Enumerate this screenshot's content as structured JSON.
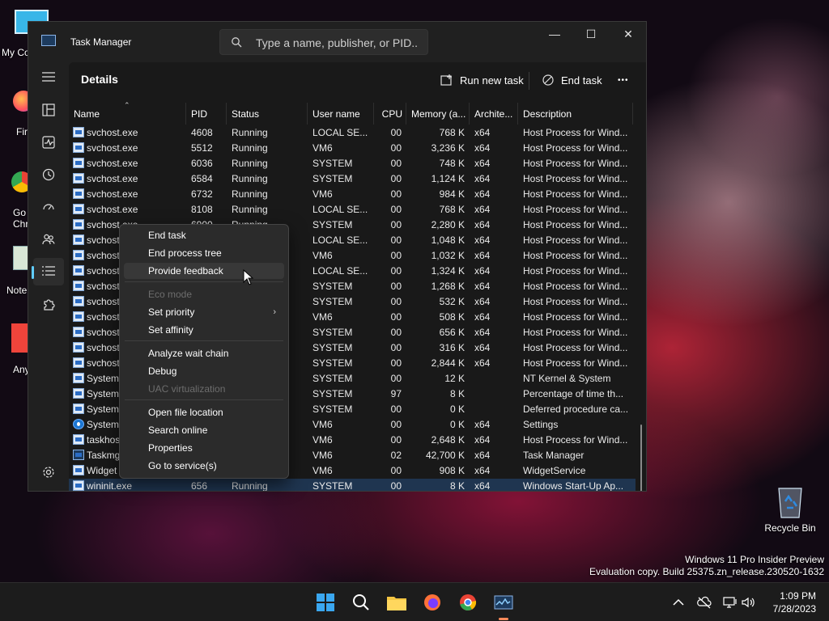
{
  "desktop": {
    "icons": [
      {
        "label": "My Co"
      },
      {
        "label": "Fir"
      },
      {
        "label": "Go Chr"
      },
      {
        "label": "Note"
      },
      {
        "label": "Any"
      }
    ],
    "recycle_bin": "Recycle Bin",
    "watermark_line1": "Windows 11 Pro Insider Preview",
    "watermark_line2": "Evaluation copy. Build 25375.zn_release.230520-1632"
  },
  "window": {
    "title": "Task Manager",
    "search_placeholder": "Type a name, publisher, or PID...",
    "minimize": "—",
    "maximize": "☐",
    "close": "✕"
  },
  "toolbar": {
    "page_title": "Details",
    "run_new_task": "Run new task",
    "end_task": "End task",
    "more": "•••"
  },
  "table": {
    "columns": [
      "Name",
      "PID",
      "Status",
      "User name",
      "CPU",
      "Memory (a...",
      "Archite...",
      "Description"
    ],
    "rows": [
      {
        "name": "svchost.exe",
        "pid": "4608",
        "status": "Running",
        "user": "LOCAL SE...",
        "cpu": "00",
        "mem": "768 K",
        "arch": "x64",
        "desc": "Host Process for Wind..."
      },
      {
        "name": "svchost.exe",
        "pid": "5512",
        "status": "Running",
        "user": "VM6",
        "cpu": "00",
        "mem": "3,236 K",
        "arch": "x64",
        "desc": "Host Process for Wind..."
      },
      {
        "name": "svchost.exe",
        "pid": "6036",
        "status": "Running",
        "user": "SYSTEM",
        "cpu": "00",
        "mem": "748 K",
        "arch": "x64",
        "desc": "Host Process for Wind..."
      },
      {
        "name": "svchost.exe",
        "pid": "6584",
        "status": "Running",
        "user": "SYSTEM",
        "cpu": "00",
        "mem": "1,124 K",
        "arch": "x64",
        "desc": "Host Process for Wind..."
      },
      {
        "name": "svchost.exe",
        "pid": "6732",
        "status": "Running",
        "user": "VM6",
        "cpu": "00",
        "mem": "984 K",
        "arch": "x64",
        "desc": "Host Process for Wind..."
      },
      {
        "name": "svchost.exe",
        "pid": "8108",
        "status": "Running",
        "user": "LOCAL SE...",
        "cpu": "00",
        "mem": "768 K",
        "arch": "x64",
        "desc": "Host Process for Wind..."
      },
      {
        "name": "svchost.exe",
        "pid": "6900",
        "status": "Running",
        "user": "SYSTEM",
        "cpu": "00",
        "mem": "2,280 K",
        "arch": "x64",
        "desc": "Host Process for Wind..."
      },
      {
        "name": "svchost",
        "pid": "",
        "status": "",
        "user": "LOCAL SE...",
        "cpu": "00",
        "mem": "1,048 K",
        "arch": "x64",
        "desc": "Host Process for Wind..."
      },
      {
        "name": "svchost",
        "pid": "",
        "status": "",
        "user": "VM6",
        "cpu": "00",
        "mem": "1,032 K",
        "arch": "x64",
        "desc": "Host Process for Wind..."
      },
      {
        "name": "svchost",
        "pid": "",
        "status": "",
        "user": "LOCAL SE...",
        "cpu": "00",
        "mem": "1,324 K",
        "arch": "x64",
        "desc": "Host Process for Wind..."
      },
      {
        "name": "svchost",
        "pid": "",
        "status": "",
        "user": "SYSTEM",
        "cpu": "00",
        "mem": "1,268 K",
        "arch": "x64",
        "desc": "Host Process for Wind..."
      },
      {
        "name": "svchost",
        "pid": "",
        "status": "",
        "user": "SYSTEM",
        "cpu": "00",
        "mem": "532 K",
        "arch": "x64",
        "desc": "Host Process for Wind..."
      },
      {
        "name": "svchost",
        "pid": "",
        "status": "",
        "user": "VM6",
        "cpu": "00",
        "mem": "508 K",
        "arch": "x64",
        "desc": "Host Process for Wind..."
      },
      {
        "name": "svchost",
        "pid": "",
        "status": "",
        "user": "SYSTEM",
        "cpu": "00",
        "mem": "656 K",
        "arch": "x64",
        "desc": "Host Process for Wind..."
      },
      {
        "name": "svchost",
        "pid": "",
        "status": "",
        "user": "SYSTEM",
        "cpu": "00",
        "mem": "316 K",
        "arch": "x64",
        "desc": "Host Process for Wind..."
      },
      {
        "name": "svchost",
        "pid": "",
        "status": "",
        "user": "SYSTEM",
        "cpu": "00",
        "mem": "2,844 K",
        "arch": "x64",
        "desc": "Host Process for Wind..."
      },
      {
        "name": "System",
        "pid": "",
        "status": "",
        "user": "SYSTEM",
        "cpu": "00",
        "mem": "12 K",
        "arch": "",
        "desc": "NT Kernel & System"
      },
      {
        "name": "System",
        "pid": "",
        "status": "",
        "user": "SYSTEM",
        "cpu": "97",
        "mem": "8 K",
        "arch": "",
        "desc": "Percentage of time th..."
      },
      {
        "name": "System",
        "pid": "",
        "status": "",
        "user": "SYSTEM",
        "cpu": "00",
        "mem": "0 K",
        "arch": "",
        "desc": "Deferred procedure ca..."
      },
      {
        "name": "SystemS",
        "pid": "",
        "status": "",
        "user": "VM6",
        "cpu": "00",
        "mem": "0 K",
        "arch": "x64",
        "desc": "Settings"
      },
      {
        "name": "taskhos",
        "pid": "",
        "status": "",
        "user": "VM6",
        "cpu": "00",
        "mem": "2,648 K",
        "arch": "x64",
        "desc": "Host Process for Wind..."
      },
      {
        "name": "Taskmg",
        "pid": "",
        "status": "",
        "user": "VM6",
        "cpu": "02",
        "mem": "42,700 K",
        "arch": "x64",
        "desc": "Task Manager"
      },
      {
        "name": "Widget",
        "pid": "",
        "status": "",
        "user": "VM6",
        "cpu": "00",
        "mem": "908 K",
        "arch": "x64",
        "desc": "WidgetService"
      },
      {
        "name": "wininit.exe",
        "pid": "656",
        "status": "Running",
        "user": "SYSTEM",
        "cpu": "00",
        "mem": "8 K",
        "arch": "x64",
        "desc": "Windows Start-Up Ap..."
      }
    ]
  },
  "context_menu": {
    "items": [
      {
        "label": "End task"
      },
      {
        "label": "End process tree"
      },
      {
        "label": "Provide feedback"
      },
      {
        "label": "Eco mode"
      },
      {
        "label": "Set priority"
      },
      {
        "label": "Set affinity"
      },
      {
        "label": "Analyze wait chain"
      },
      {
        "label": "Debug"
      },
      {
        "label": "UAC virtualization"
      },
      {
        "label": "Open file location"
      },
      {
        "label": "Search online"
      },
      {
        "label": "Properties"
      },
      {
        "label": "Go to service(s)"
      }
    ],
    "submenu_arrow": "›"
  },
  "taskbar": {
    "time": "1:09 PM",
    "date": "7/28/2023",
    "apps": [
      "start-icon",
      "search-icon",
      "file-explorer-icon",
      "firefox-icon",
      "chrome-icon",
      "task-manager-icon"
    ]
  },
  "colors": {
    "accent": "#60cdff",
    "selection": "#1f3550",
    "menu_bg": "#2b2b2b"
  }
}
